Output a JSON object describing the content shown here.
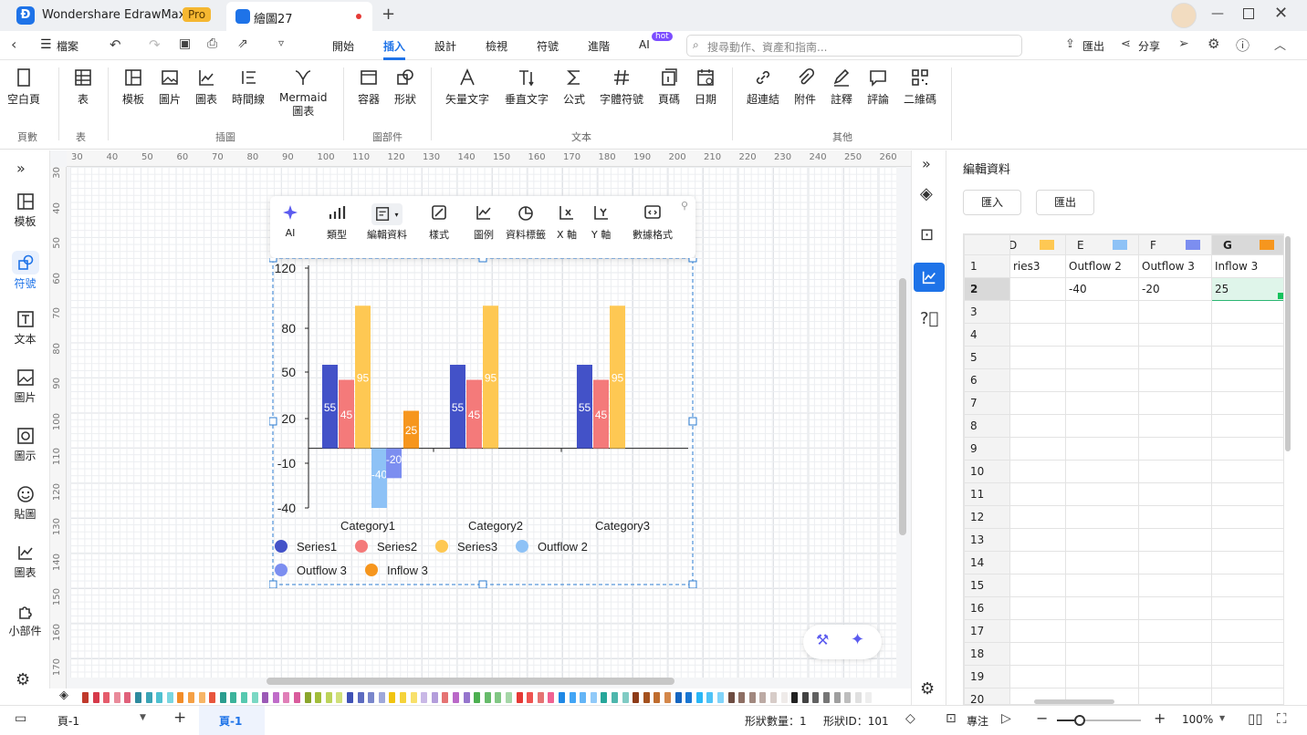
{
  "app": {
    "name": "Wondershare EdrawMax",
    "badge": "Pro",
    "tab_title": "繪圖27"
  },
  "menu": {
    "file": "檔案",
    "tabs": [
      "開始",
      "插入",
      "設計",
      "檢視",
      "符號",
      "進階",
      "AI"
    ],
    "active_tab": "插入",
    "ai_badge": "hot",
    "search_placeholder": "搜尋動作、資產和指南...",
    "export": "匯出",
    "share": "分享"
  },
  "ribbon": {
    "buttons": [
      {
        "label": "空白頁",
        "icon": "page-icon"
      },
      {
        "label": "表",
        "icon": "table-icon"
      },
      {
        "label": "模板",
        "icon": "template-icon"
      },
      {
        "label": "圖片",
        "icon": "image-icon"
      },
      {
        "label": "圖表",
        "icon": "chart-icon"
      },
      {
        "label": "時間線",
        "icon": "timeline-icon"
      },
      {
        "label": "Mermaid\n圖表",
        "icon": "mermaid-icon"
      },
      {
        "label": "容器",
        "icon": "container-icon"
      },
      {
        "label": "形狀",
        "icon": "shape-icon"
      },
      {
        "label": "矢量文字",
        "icon": "vector-text-icon"
      },
      {
        "label": "垂直文字",
        "icon": "vertical-text-icon"
      },
      {
        "label": "公式",
        "icon": "formula-icon"
      },
      {
        "label": "字體符號",
        "icon": "symbol-icon"
      },
      {
        "label": "頁碼",
        "icon": "page-number-icon"
      },
      {
        "label": "日期",
        "icon": "calendar-icon"
      },
      {
        "label": "超連結",
        "icon": "link-icon"
      },
      {
        "label": "附件",
        "icon": "attachment-icon"
      },
      {
        "label": "註釋",
        "icon": "annotation-icon"
      },
      {
        "label": "評論",
        "icon": "comment-icon"
      },
      {
        "label": "二維碼",
        "icon": "qrcode-icon"
      }
    ],
    "groups": [
      "頁數",
      "表",
      "插圖",
      "圖部件",
      "文本",
      "其他"
    ]
  },
  "leftbar": [
    {
      "label": "模板",
      "icon": "template-icon"
    },
    {
      "label": "符號",
      "icon": "symbol-icon"
    },
    {
      "label": "文本",
      "icon": "text-icon"
    },
    {
      "label": "圖片",
      "icon": "image-icon"
    },
    {
      "label": "圖示",
      "icon": "icon-icon"
    },
    {
      "label": "貼圖",
      "icon": "sticker-icon"
    },
    {
      "label": "圖表",
      "icon": "chart-icon"
    },
    {
      "label": "小部件",
      "icon": "widget-icon"
    }
  ],
  "ruler": {
    "h": [
      "30",
      "40",
      "50",
      "60",
      "70",
      "80",
      "90",
      "100",
      "110",
      "120",
      "130",
      "140",
      "150",
      "160",
      "170",
      "180",
      "190",
      "200",
      "210",
      "220",
      "230",
      "240",
      "250",
      "260"
    ],
    "v": [
      "30",
      "40",
      "50",
      "60",
      "70",
      "80",
      "90",
      "100",
      "110",
      "120",
      "130",
      "140",
      "150",
      "160",
      "170"
    ]
  },
  "chart_toolbar": [
    {
      "label": "AI",
      "icon": "sparkle-icon"
    },
    {
      "label": "類型",
      "icon": "bar-type-icon"
    },
    {
      "label": "編輯資料",
      "icon": "edit-data-icon"
    },
    {
      "label": "樣式",
      "icon": "style-icon"
    },
    {
      "label": "圖例",
      "icon": "legend-icon"
    },
    {
      "label": "資料標籤",
      "icon": "data-label-icon"
    },
    {
      "label": "X 軸",
      "icon": "x-axis-icon"
    },
    {
      "label": "Y 軸",
      "icon": "y-axis-icon"
    },
    {
      "label": "數據格式",
      "icon": "data-format-icon"
    }
  ],
  "chart_data": {
    "type": "bar",
    "categories": [
      "Category1",
      "Category2",
      "Category3"
    ],
    "yticks": [
      "120",
      "80",
      "50",
      "20",
      "-10",
      "-40"
    ],
    "ytick_values": [
      120,
      80,
      50,
      20,
      -10,
      -40
    ],
    "series": [
      {
        "name": "Series1",
        "color": "#4352c8",
        "values": [
          55,
          55,
          55
        ]
      },
      {
        "name": "Series2",
        "color": "#f47a7a",
        "values": [
          45,
          45,
          45
        ]
      },
      {
        "name": "Series3",
        "color": "#fec853",
        "values": [
          95,
          95,
          95
        ]
      },
      {
        "name": "Outflow 2",
        "color": "#8ec2f6",
        "values": [
          -40,
          null,
          null
        ]
      },
      {
        "name": "Outflow 3",
        "color": "#7c8ef0",
        "values": [
          -20,
          null,
          null
        ]
      },
      {
        "name": "Inflow 3",
        "color": "#f6961e",
        "values": [
          25,
          null,
          null
        ]
      }
    ]
  },
  "panel": {
    "title": "編輯資料",
    "import": "匯入",
    "export": "匯出",
    "columns": [
      {
        "letter": "D",
        "color": "#fec853"
      },
      {
        "letter": "E",
        "color": "#8ec2f6"
      },
      {
        "letter": "F",
        "color": "#7c8ef0"
      },
      {
        "letter": "G",
        "color": "#f6961e"
      }
    ],
    "row1": [
      "ries3",
      "Outflow 2",
      "Outflow 3",
      "Inflow 3"
    ],
    "row2": [
      "",
      "-40",
      "-20",
      "25"
    ],
    "row_numbers": [
      "1",
      "2",
      "3",
      "4",
      "5",
      "6",
      "7",
      "8",
      "9",
      "10",
      "11",
      "12",
      "13",
      "14",
      "15",
      "16",
      "17",
      "18",
      "19",
      "20"
    ]
  },
  "status": {
    "page_select": "頁-1",
    "page_tab": "頁-1",
    "shape_count": "形狀數量：1",
    "shape_id": "形狀ID：101",
    "focus": "專注",
    "zoom": "100%"
  },
  "palette": [
    "#c0392b",
    "#d63a4a",
    "#e55b6b",
    "#e98a9a",
    "#e0607a",
    "#2e8a9e",
    "#3aa3b5",
    "#4ec0d0",
    "#7ad6e0",
    "#f28c28",
    "#f5a045",
    "#f7b566",
    "#e8553d",
    "#2a9d8f",
    "#3bb39b",
    "#56c9b0",
    "#7ad8c4",
    "#9b59b6",
    "#c06cc9",
    "#e07fb8",
    "#d95b9c",
    "#8aa52b",
    "#a1bd3a",
    "#bcd35a",
    "#d0e07a",
    "#3f51b5",
    "#5c6bc0",
    "#7986cb",
    "#9fa8da",
    "#f1c40f",
    "#f5d33a",
    "#f8e06a",
    "#c9b8e6",
    "#b39ddb",
    "#e57373",
    "#ba68c8",
    "#9575cd",
    "#4caf50",
    "#66bb6a",
    "#81c784",
    "#a5d6a7",
    "#e53935",
    "#ef5350",
    "#e57373",
    "#f06292",
    "#1e88e5",
    "#42a5f5",
    "#64b5f6",
    "#90caf9",
    "#26a69a",
    "#4db6ac",
    "#80cbc4",
    "#8d3b18",
    "#a4511e",
    "#bf6c2e",
    "#d4874a",
    "#1565c0",
    "#1976d2",
    "#29b6f6",
    "#4fc3f7",
    "#81d4fa",
    "#6d4c41",
    "#8d6e63",
    "#a1887f",
    "#bcaaa4",
    "#d7ccc8",
    "#efebe9",
    "#212121",
    "#424242",
    "#616161",
    "#757575",
    "#9e9e9e",
    "#bdbdbd",
    "#e0e0e0",
    "#eeeeee"
  ]
}
